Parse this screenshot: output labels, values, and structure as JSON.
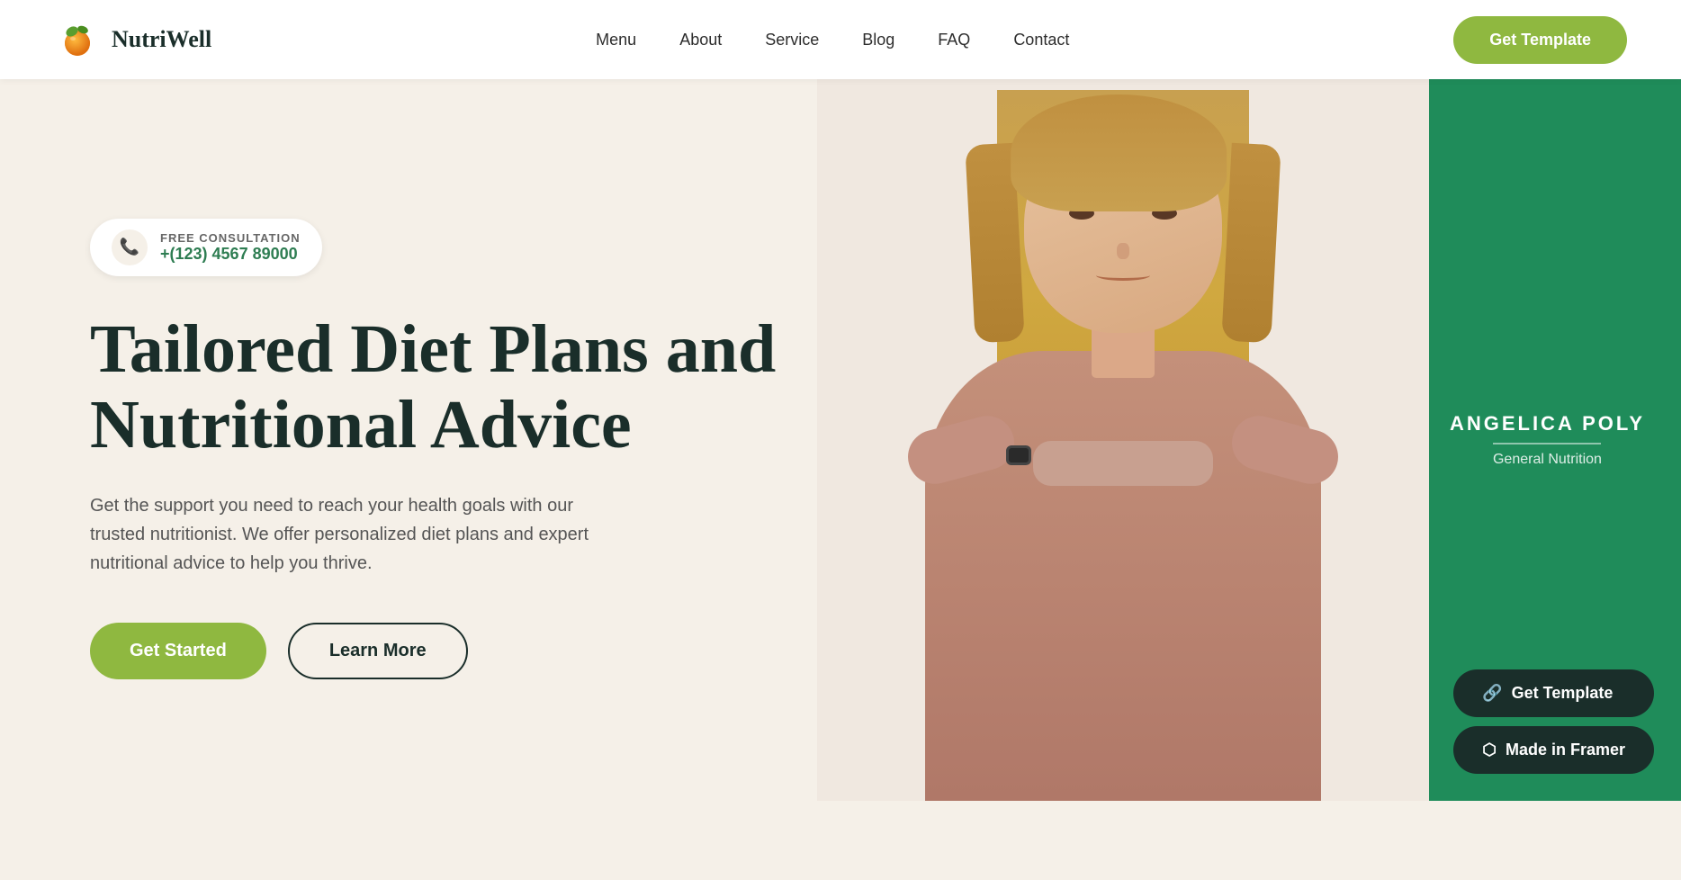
{
  "brand": {
    "name": "NutriWell",
    "logo_alt": "NutriWell logo"
  },
  "navbar": {
    "links": [
      {
        "label": "Menu",
        "href": "#"
      },
      {
        "label": "About",
        "href": "#"
      },
      {
        "label": "Service",
        "href": "#"
      },
      {
        "label": "Blog",
        "href": "#"
      },
      {
        "label": "FAQ",
        "href": "#"
      },
      {
        "label": "Contact",
        "href": "#"
      }
    ],
    "cta_label": "Get Template"
  },
  "hero": {
    "consultation_label": "FREE CONSULTATION",
    "phone": "+(123) 4567 89000",
    "title": "Tailored Diet Plans and Nutritional Advice",
    "subtitle": "Get the support you need to reach your health goals with our trusted nutritionist. We offer personalized diet plans and expert nutritional advice to help you thrive.",
    "btn_primary": "Get Started",
    "btn_secondary": "Learn More"
  },
  "profile": {
    "name": "ANGELICA POLY",
    "divider": "──────────",
    "role": "General Nutrition"
  },
  "footer_btns": {
    "get_template": "Get Template",
    "made_in_framer": "Made in Framer"
  },
  "colors": {
    "accent_green": "#8fb840",
    "dark_green": "#1f8c5a",
    "dark": "#1a2e2a",
    "phone_color": "#2e7d52",
    "bg": "#f5f0e8"
  },
  "icons": {
    "phone": "📞",
    "link": "🔗",
    "framer": "⬡"
  }
}
